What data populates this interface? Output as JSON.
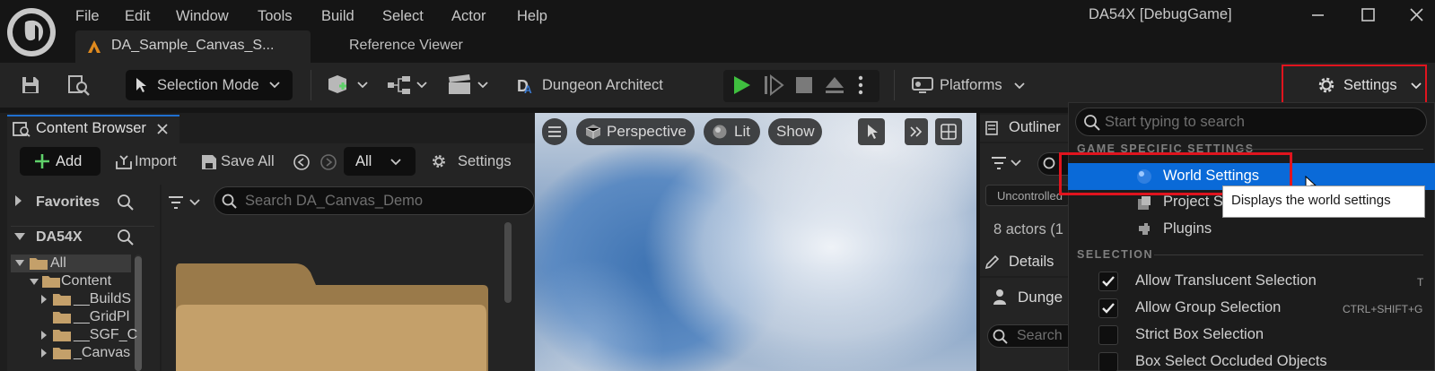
{
  "window": {
    "title": "DA54X [DebugGame]",
    "menu": [
      "File",
      "Edit",
      "Window",
      "Tools",
      "Build",
      "Select",
      "Actor",
      "Help"
    ]
  },
  "tabs": {
    "active": "DA_Sample_Canvas_S...",
    "second": "Reference Viewer"
  },
  "toolbar": {
    "selection_mode": "Selection Mode",
    "dungeon_architect": "Dungeon Architect",
    "platforms": "Platforms",
    "settings": "Settings"
  },
  "content_browser": {
    "tab_label": "Content Browser",
    "add": "Add",
    "import": "Import",
    "save_all": "Save All",
    "filter_value": "All",
    "settings": "Settings",
    "favorites": "Favorites",
    "root": "DA54X",
    "search_placeholder": "Search DA_Canvas_Demo",
    "tree": [
      "All",
      "Content",
      "__BuildS",
      "__GridPl",
      "__SGF_C",
      "_Canvas"
    ]
  },
  "viewport": {
    "perspective": "Perspective",
    "lit": "Lit",
    "show": "Show"
  },
  "outliner": {
    "tab_label": "Outliner",
    "uncontrolled": "Uncontrolled",
    "actor_count": "8 actors (1",
    "details_label": "Details",
    "details_item": "Dunge",
    "search_partial": "Search"
  },
  "settings_menu": {
    "search_placeholder": "Start typing to search",
    "section_game": "GAME SPECIFIC SETTINGS",
    "world_settings": "World Settings",
    "project_settings": "Project Setti",
    "plugins": "Plugins",
    "section_selection": "SELECTION",
    "options": [
      {
        "label": "Allow Translucent Selection",
        "shortcut": "T",
        "checked": true
      },
      {
        "label": "Allow Group Selection",
        "shortcut": "CTRL+SHIFT+G",
        "checked": true
      },
      {
        "label": "Strict Box Selection",
        "shortcut": "",
        "checked": false
      },
      {
        "label": "Box Select Occluded Objects",
        "shortcut": "",
        "checked": false
      }
    ],
    "tooltip": "Displays the world settings"
  },
  "colors": {
    "highlight_blue": "#0a6ad8",
    "annotation_red": "#e0141e",
    "play_green": "#3fbf3f",
    "folder": "#c4a06a"
  }
}
